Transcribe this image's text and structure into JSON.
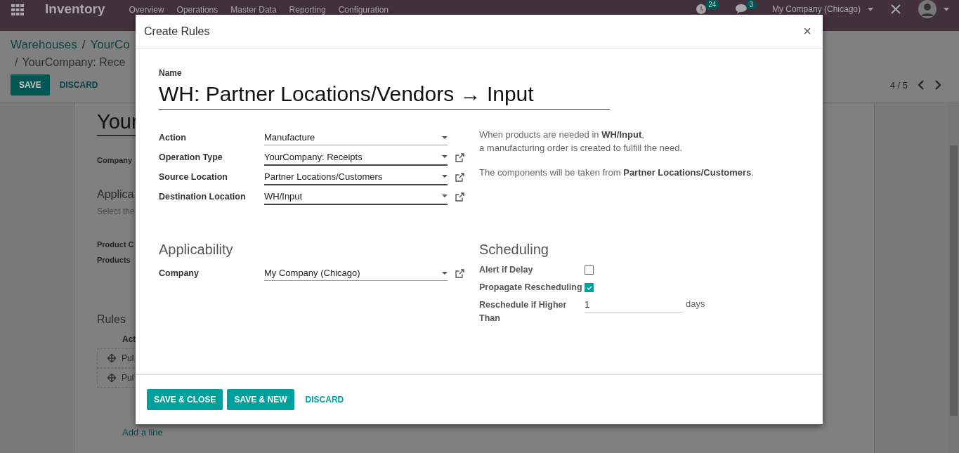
{
  "navbar": {
    "app_name": "Inventory",
    "menu": [
      "Overview",
      "Operations",
      "Master Data",
      "Reporting",
      "Configuration"
    ],
    "activity_count": "24",
    "message_count": "3",
    "company": "My Company (Chicago)"
  },
  "breadcrumbs": [
    "Warehouses",
    "YourCo"
  ],
  "breadcrumb_separator": "/",
  "breadcrumb_current": "YourCompany: Rece",
  "form_buttons": [
    {
      "label": "SAVE",
      "kind": "primary"
    },
    {
      "label": "DISCARD",
      "kind": "link"
    }
  ],
  "pager": "4 / 5",
  "sheet": {
    "title": "Your",
    "company_label": "Company",
    "applicability_heading": "Applica",
    "applicability_hint": "Select the",
    "labels": [
      "Product C",
      "Products"
    ],
    "rules_heading": "Rules",
    "rules_column": "Act",
    "rules_rows": [
      "Pul",
      "Pul"
    ],
    "add_line": "Add a line"
  },
  "dialog": {
    "title": "Create Rules",
    "close": "×",
    "name_label": "Name",
    "name_value": "WH: Partner Locations/Vendors → Input",
    "fields": [
      {
        "label": "Action",
        "value": "Manufacture",
        "link": false
      },
      {
        "label": "Operation Type",
        "value": "YourCompany: Receipts",
        "link": true
      },
      {
        "label": "Source Location",
        "value": "Partner Locations/Customers",
        "link": true
      },
      {
        "label": "Destination Location",
        "value": "WH/Input",
        "link": true
      }
    ],
    "help": [
      [
        "When products are needed in **WH/Input**,",
        "a manufacturing order is created to fulfill the need."
      ],
      [
        "The components will be taken from **Partner Locations/Customers**."
      ]
    ],
    "applicability": {
      "heading": "Applicability",
      "label": "Company",
      "value": "My Company (Chicago)",
      "link": true
    },
    "scheduling": {
      "heading": "Scheduling",
      "items": [
        {
          "kind": "checkbox",
          "label": "Alert if Delay",
          "checked": false
        },
        {
          "kind": "checkbox",
          "label": "Propagate Rescheduling",
          "checked": true
        },
        {
          "kind": "number",
          "label": "Reschedule if Higher Than",
          "value": "1",
          "unit": "days"
        }
      ]
    },
    "buttons": [
      {
        "label": "SAVE & CLOSE",
        "kind": "primary"
      },
      {
        "label": "SAVE & NEW",
        "kind": "primary"
      },
      {
        "label": "DISCARD",
        "kind": "link"
      }
    ]
  }
}
